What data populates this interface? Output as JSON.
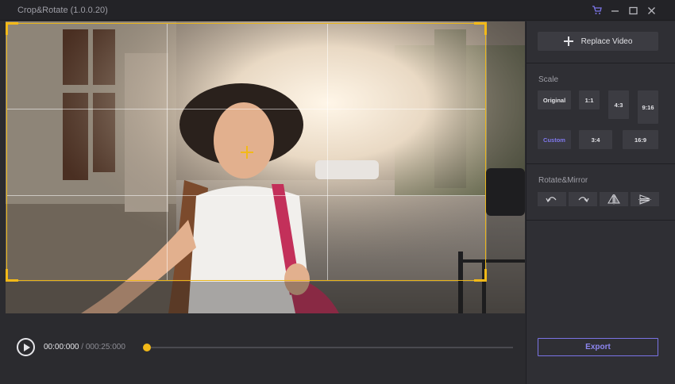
{
  "window": {
    "title": "Crop&Rotate (1.0.0.20)",
    "controls": [
      "cart-icon",
      "minimize-icon",
      "maximize-icon",
      "close-icon"
    ]
  },
  "player": {
    "current_time": "00:00:000",
    "separator": " / ",
    "total_time": "000:25:000",
    "progress": 0
  },
  "panel": {
    "replace_label": "Replace Video",
    "scale_title": "Scale",
    "scale_options": [
      "Original",
      "1:1",
      "4:3",
      "9:16",
      "Custom",
      "3:4",
      "16:9"
    ],
    "selected_scale": "Custom",
    "rotate_title": "Rotate&Mirror",
    "rotate_actions": [
      "rotate-left-icon",
      "rotate-right-icon",
      "flip-horizontal-icon",
      "flip-vertical-icon"
    ],
    "export_label": "Export"
  },
  "colors": {
    "accent": "#7b74e6",
    "crop_frame": "#f2b918",
    "panel_bg": "#2f2f34",
    "window_bg": "#2b2b2f"
  }
}
